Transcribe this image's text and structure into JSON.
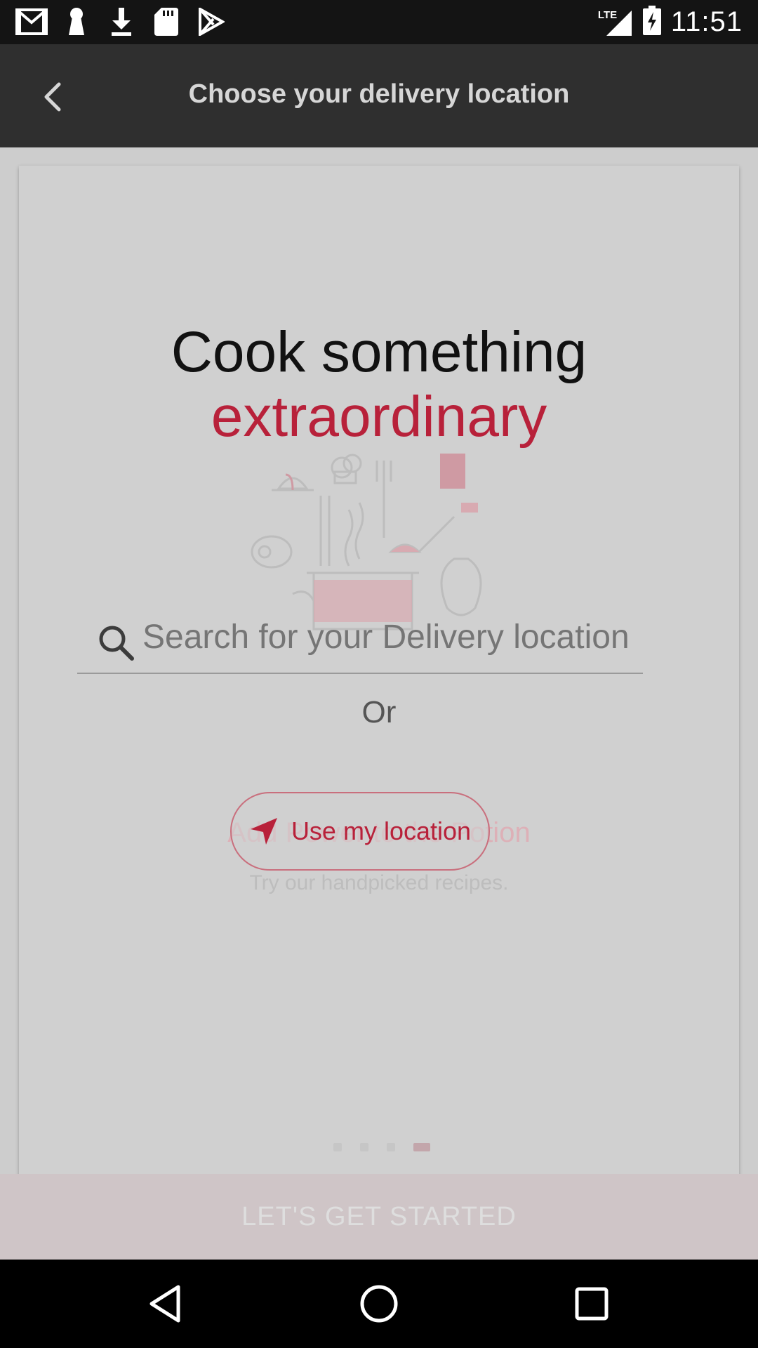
{
  "status_bar": {
    "time": "11:51",
    "network": "LTE",
    "left_icons": [
      "gmail-icon",
      "keyhole-icon",
      "download-icon",
      "sd-card-icon",
      "play-store-icon"
    ],
    "right_icons": [
      "signal-icon",
      "battery-charging-icon"
    ]
  },
  "app_bar": {
    "title": "Choose your delivery location",
    "back_icon": "chevron-left-icon"
  },
  "card": {
    "headline": "Cook something",
    "headline_accent": "extraordinary",
    "ghost_title": "Add Power to the Potion",
    "ghost_subtitle": "Try our handpicked recipes.",
    "page_indicator": {
      "count": 4,
      "active_index": 3
    }
  },
  "search": {
    "placeholder": "Search for your Delivery location",
    "icon": "search-icon"
  },
  "or_text": "Or",
  "location_button": {
    "label": "Use my location",
    "icon": "navigation-arrow-icon"
  },
  "start_button": {
    "label": "LET'S GET STARTED"
  },
  "colors": {
    "accent": "#b8213a",
    "app_bar": "#2f2f2f",
    "overlay": "#cdcdcd"
  },
  "nav_bar": {
    "icons": [
      "back-triangle-icon",
      "home-circle-icon",
      "recents-square-icon"
    ]
  }
}
